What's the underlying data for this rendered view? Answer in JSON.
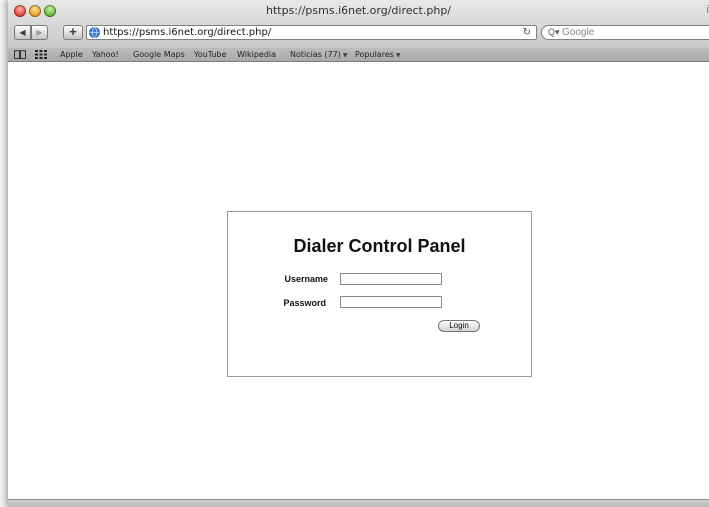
{
  "window": {
    "title": "https://psms.i6net.org/direct.php/",
    "edge_label": "i"
  },
  "toolbar": {
    "back_icon": "◀",
    "forward_icon": "▶",
    "add_bookmark_icon": "+",
    "address": "https://psms.i6net.org/direct.php/",
    "reload_icon": "↻",
    "search_placeholder": "Google",
    "search_icon": "Q▾"
  },
  "bookmarks": {
    "items": [
      "Apple",
      "Yahoo!",
      "Google Maps",
      "YouTube",
      "Wikipedia",
      "Noticias (77)",
      "Populares"
    ]
  },
  "login": {
    "title": "Dialer Control Panel",
    "username_label": "Username",
    "password_label": "Password",
    "username_value": "",
    "password_value": "",
    "submit_label": "Login"
  },
  "colors": {
    "close": "#e2382c",
    "minimize": "#e39c17",
    "zoom": "#5bb133"
  }
}
